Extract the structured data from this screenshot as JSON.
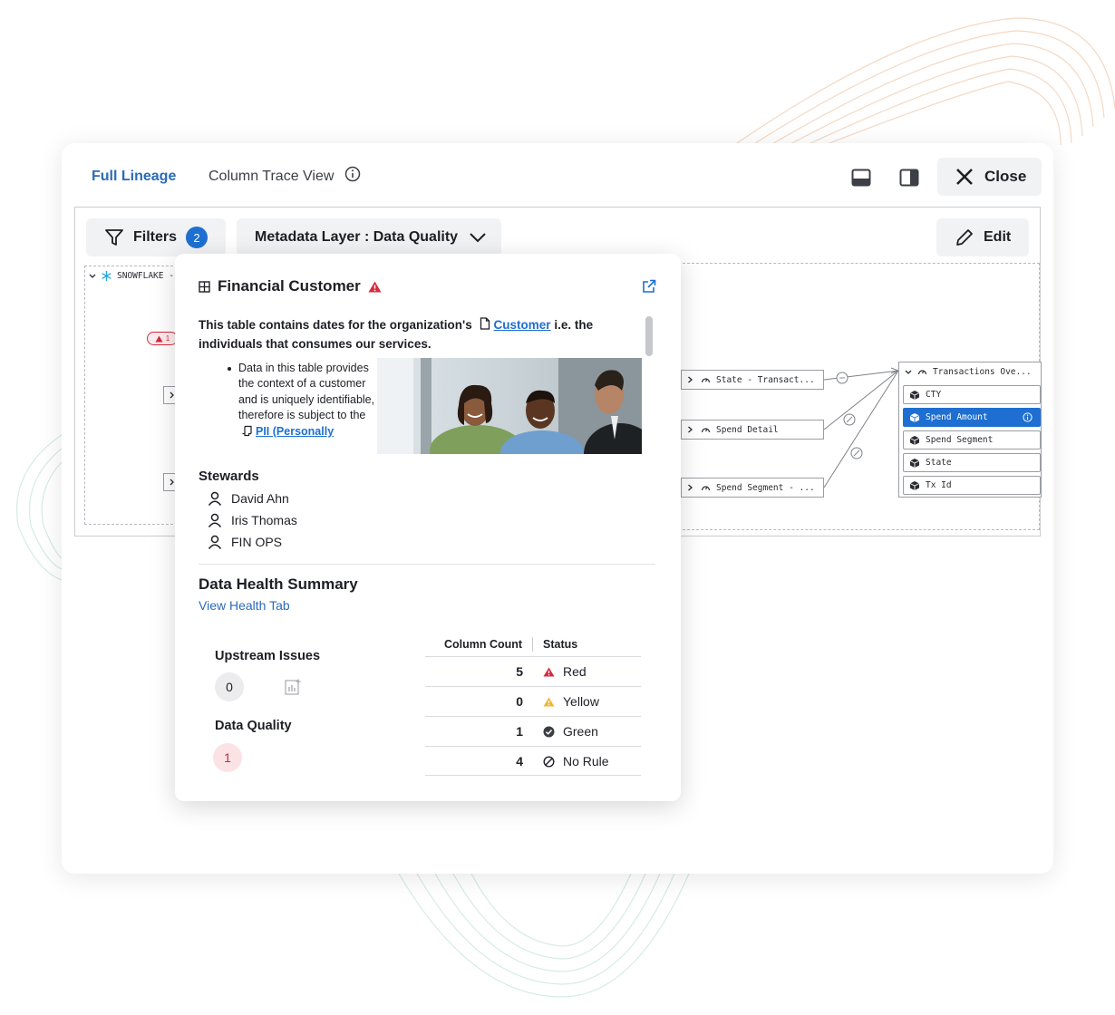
{
  "header": {
    "tab_full": "Full Lineage",
    "tab_column": "Column Trace View",
    "close_label": "Close"
  },
  "toolbar": {
    "filters_label": "Filters",
    "filters_count": "2",
    "metadata_layer": "Metadata Layer : Data Quality",
    "edit_label": "Edit"
  },
  "lineage": {
    "source_group": "SNOWFLAKE -",
    "alert_badge": "1",
    "nodes": [
      "State - Transact...",
      "Spend Detail",
      "Spend Segment - ..."
    ],
    "target_table": "Transactions Ove...",
    "target_columns": [
      "CTY",
      "Spend Amount",
      "Spend Segment",
      "State",
      "Tx Id"
    ]
  },
  "popover": {
    "title": "Financial Customer",
    "description_part1": "This table contains dates for the organization's",
    "description_link": "Customer",
    "description_part2": "i.e. the individuals that consumes our services.",
    "bullet_text": "Data in this table provides the context of a customer and is uniquely identifiable, therefore is subject to the",
    "bullet_link": "PII (Personally",
    "stewards_title": "Stewards",
    "stewards": [
      "David Ahn",
      "Iris Thomas",
      "FIN OPS"
    ],
    "health_title": "Data Health Summary",
    "health_link": "View Health Tab",
    "upstream_label": "Upstream Issues",
    "upstream_count": "0",
    "dq_label": "Data Quality",
    "dq_count": "1",
    "table_headers": [
      "Column Count",
      "Status"
    ],
    "table_rows": [
      {
        "count": "5",
        "status": "Red"
      },
      {
        "count": "0",
        "status": "Yellow"
      },
      {
        "count": "1",
        "status": "Green"
      },
      {
        "count": "4",
        "status": "No Rule"
      }
    ]
  },
  "colors": {
    "accent": "#1e6fd1",
    "red": "#d6293e",
    "yellow": "#f2b630",
    "green_icon": "#3a3d42"
  }
}
